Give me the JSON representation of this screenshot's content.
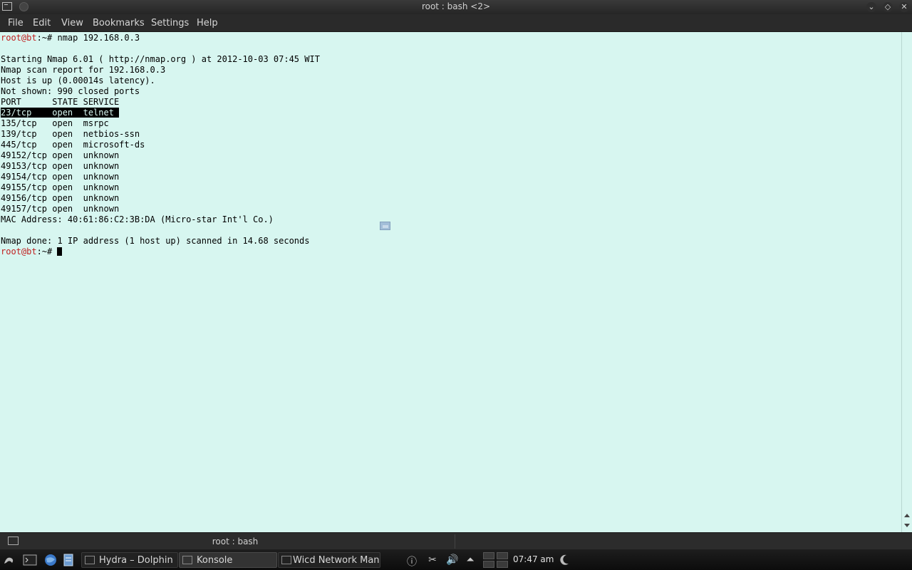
{
  "window": {
    "title": "root : bash <2>"
  },
  "menu": [
    "File",
    "Edit",
    "View",
    "Bookmarks",
    "Settings",
    "Help"
  ],
  "terminal": {
    "prompt_user": "root@bt",
    "prompt_path": ":~# ",
    "command": "nmap 192.168.0.3",
    "blank": "",
    "lines": [
      "Starting Nmap 6.01 ( http://nmap.org ) at 2012-10-03 07:45 WIT",
      "Nmap scan report for 192.168.0.3",
      "Host is up (0.00014s latency).",
      "Not shown: 990 closed ports",
      "PORT      STATE SERVICE"
    ],
    "highlighted_line": "23/tcp    open  telnet ",
    "port_lines": [
      "135/tcp   open  msrpc",
      "139/tcp   open  netbios-ssn",
      "445/tcp   open  microsoft-ds",
      "49152/tcp open  unknown",
      "49153/tcp open  unknown",
      "49154/tcp open  unknown",
      "49155/tcp open  unknown",
      "49156/tcp open  unknown",
      "49157/tcp open  unknown",
      "MAC Address: 40:61:86:C2:3B:DA (Micro-star Int'l Co.)"
    ],
    "done_line": "Nmap done: 1 IP address (1 host up) scanned in 14.68 seconds",
    "final_prompt_user": "root@bt",
    "final_prompt_path": ":~# "
  },
  "tabbar": {
    "tab_label": "root : bash"
  },
  "taskbar": {
    "tasks": [
      "Hydra – Dolphin",
      "Konsole",
      "Wicd Network Mana"
    ],
    "clock": "07:47 am"
  },
  "icons": {
    "launcher": "kde-launcher-icon",
    "terminal": "terminal-icon",
    "browser": "browser-globe-icon",
    "notes": "notes-icon"
  }
}
